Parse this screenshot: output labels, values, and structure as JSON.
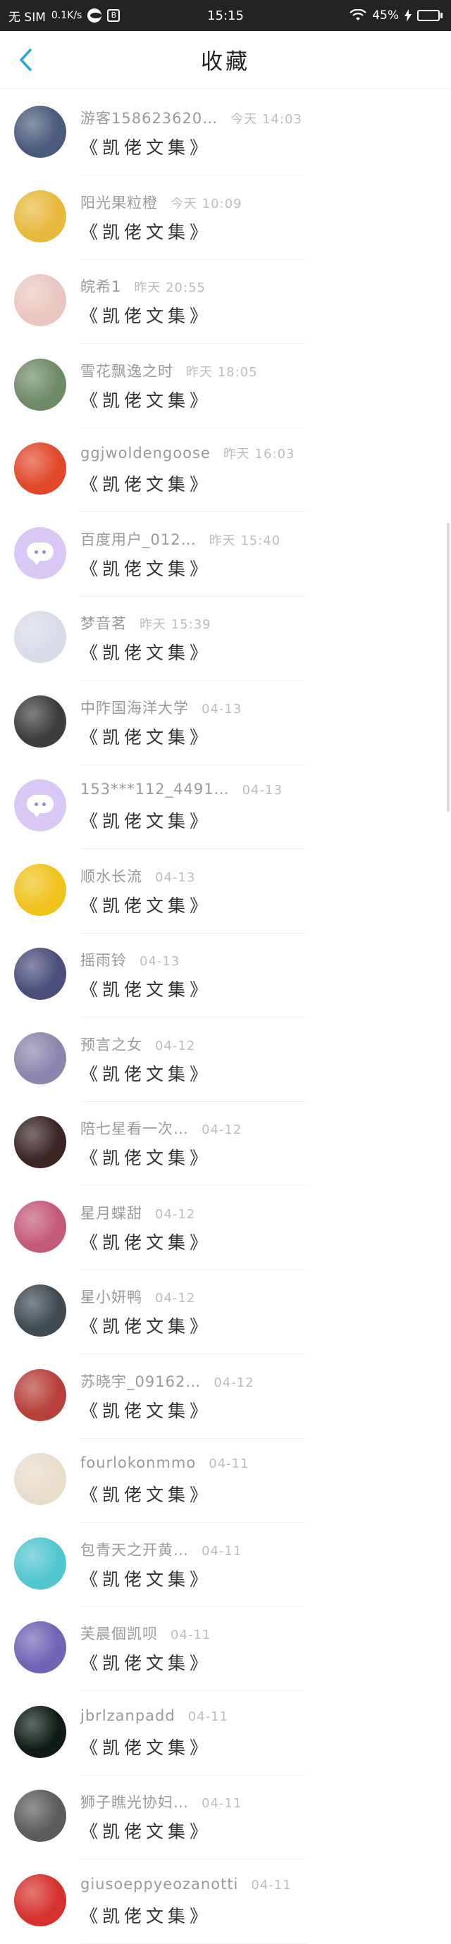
{
  "status_bar": {
    "carrier": "无 SIM",
    "speed": "0.1K/s",
    "app_badge": "B",
    "time": "15:15",
    "battery_text": "45%",
    "battery_level": 0.45
  },
  "header": {
    "title": "收藏"
  },
  "items": [
    {
      "username": "游客158623620…",
      "time": "今天 14:03",
      "title": "《凯佬文集》",
      "avatar_color": "#4a5a7c"
    },
    {
      "username": "阳光果粒橙",
      "time": "今天 10:09",
      "title": "《凯佬文集》",
      "avatar_color": "#e7b93c"
    },
    {
      "username": "皖希1",
      "time": "昨天 20:55",
      "title": "《凯佬文集》",
      "avatar_color": "#e9c7c0"
    },
    {
      "username": "雪花飘逸之时",
      "time": "昨天 18:05",
      "title": "《凯佬文集》",
      "avatar_color": "#6e8a67"
    },
    {
      "username": "ggjwoldengoose",
      "time": "昨天 16:03",
      "title": "《凯佬文集》",
      "avatar_color": "#e1482a"
    },
    {
      "username": "百度用户_012…",
      "time": "昨天 15:40",
      "title": "《凯佬文集》",
      "avatar_color": "#d9c8f6"
    },
    {
      "username": "梦音茗",
      "time": "昨天 15:39",
      "title": "《凯佬文集》",
      "avatar_color": "#d8dbe8"
    },
    {
      "username": "中阼国海洋大学",
      "time": "04-13",
      "title": "《凯佬文集》",
      "avatar_color": "#3c3c3c"
    },
    {
      "username": "153***112_4491…",
      "time": "04-13",
      "title": "《凯佬文集》",
      "avatar_color": "#d9c8f6"
    },
    {
      "username": "顺水长流",
      "time": "04-13",
      "title": "《凯佬文集》",
      "avatar_color": "#f0c21c"
    },
    {
      "username": "摇雨铃",
      "time": "04-13",
      "title": "《凯佬文集》",
      "avatar_color": "#4b4d7a"
    },
    {
      "username": "预言之女",
      "time": "04-12",
      "title": "《凯佬文集》",
      "avatar_color": "#8a86ad"
    },
    {
      "username": "陪七星看一次…",
      "time": "04-12",
      "title": "《凯佬文集》",
      "avatar_color": "#3a2424"
    },
    {
      "username": "星月蝶甜",
      "time": "04-12",
      "title": "《凯佬文集》",
      "avatar_color": "#c45a7a"
    },
    {
      "username": "星小妍鸭",
      "time": "04-12",
      "title": "《凯佬文集》",
      "avatar_color": "#3f4a52"
    },
    {
      "username": "苏晓宇_09162…",
      "time": "04-12",
      "title": "《凯佬文集》",
      "avatar_color": "#b7403a"
    },
    {
      "username": "fourlokonmmo",
      "time": "04-11",
      "title": "《凯佬文集》",
      "avatar_color": "#e8dccb"
    },
    {
      "username": "包青天之开黄…",
      "time": "04-11",
      "title": "《凯佬文集》",
      "avatar_color": "#51c6cf"
    },
    {
      "username": "芙晨個凯呗",
      "time": "04-11",
      "title": "《凯佬文集》",
      "avatar_color": "#6f64b5"
    },
    {
      "username": "jbrlzanpadd",
      "time": "04-11",
      "title": "《凯佬文集》",
      "avatar_color": "#0f1b14"
    },
    {
      "username": "狮子瞧光协妇…",
      "time": "04-11",
      "title": "《凯佬文集》",
      "avatar_color": "#5b5b5b"
    },
    {
      "username": "giusoeppyeozanotti",
      "time": "04-11",
      "title": "《凯佬文集》",
      "avatar_color": "#d6312d"
    }
  ],
  "colors": {
    "accent": "#2aa7d6",
    "status_bar_bg": "#232323"
  }
}
